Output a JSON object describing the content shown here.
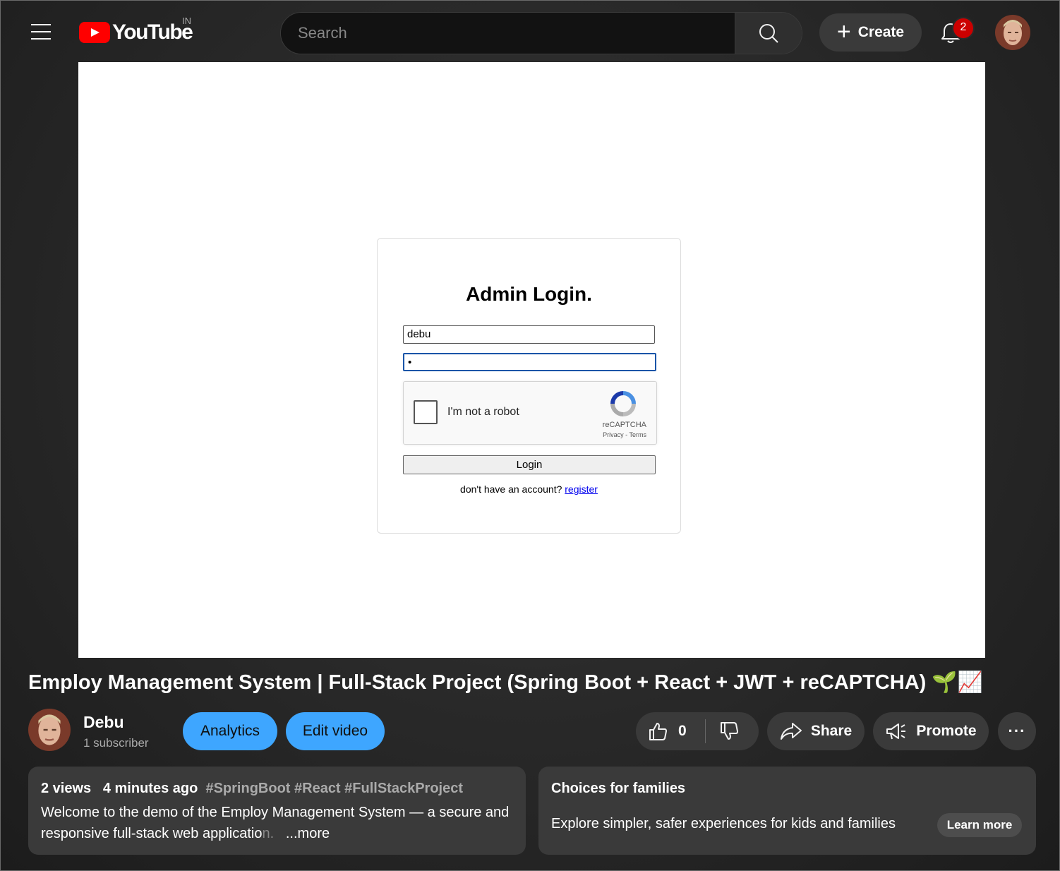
{
  "header": {
    "logo_text": "YouTube",
    "country_code": "IN",
    "search_placeholder": "Search",
    "create_label": "Create",
    "notification_count": "2"
  },
  "video_frame": {
    "login_title": "Admin Login.",
    "username_value": "debu",
    "password_mask": "•",
    "captcha_label": "I'm not a robot",
    "captcha_brand": "reCAPTCHA",
    "captcha_links": "Privacy - Terms",
    "login_button": "Login",
    "register_prompt": "don't have an account?",
    "register_link": "register"
  },
  "video": {
    "title": "Employ Management System | Full-Stack Project (Spring Boot + React + JWT + reCAPTCHA) 🌱📈",
    "channel_name": "Debu",
    "subscribers": "1 subscriber",
    "analytics_label": "Analytics",
    "edit_label": "Edit video",
    "like_count": "0",
    "share_label": "Share",
    "promote_label": "Promote",
    "more_label": "···"
  },
  "description": {
    "views": "2 views",
    "time": "4 minutes ago",
    "tags": "#SpringBoot #React #FullStackProject",
    "text": "Welcome to the demo of the Employ Management System — a secure and responsive full-stack web applicatio",
    "faded_text": "n.",
    "more_label": "...more"
  },
  "families": {
    "heading": "Choices for families",
    "text": "Explore simpler, safer experiences for kids and families",
    "learn_more": "Learn more"
  }
}
